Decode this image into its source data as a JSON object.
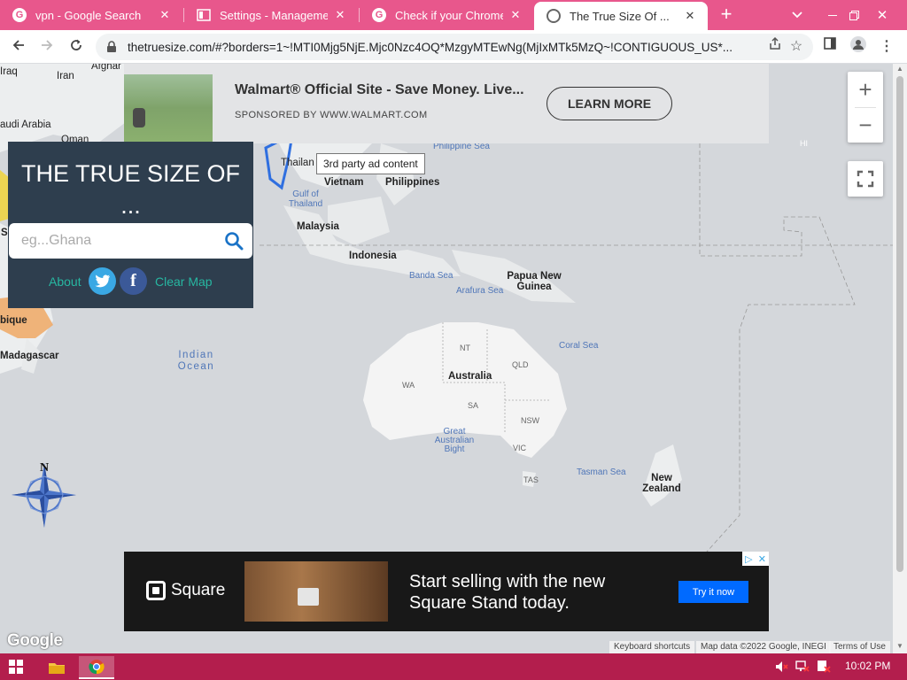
{
  "tabs": [
    {
      "label": "vpn - Google Search",
      "icon": "google-icon"
    },
    {
      "label": "Settings - Management",
      "icon": "settings-page-icon"
    },
    {
      "label": "Check if your Chrome br",
      "icon": "google-icon"
    },
    {
      "label": "The True Size Of ...",
      "icon": "globe-icon"
    }
  ],
  "address_bar": {
    "url": "thetruesize.com/#?borders=1~!MTI0Mjg5NjE.Mjc0Nzc4OQ*MzgyMTEwNg(MjIxMTk5MzQ~!CONTIGUOUS_US*..."
  },
  "top_ad": {
    "title": "Walmart® Official Site - Save Money. Live...",
    "sponsor": "SPONSORED BY WWW.WALMART.COM",
    "cta": "LEARN MORE"
  },
  "tooltip": "3rd party ad content",
  "panel": {
    "title": "THE TRUE SIZE OF ...",
    "search_placeholder": "eg...Ghana",
    "about": "About",
    "clear_map": "Clear Map"
  },
  "map_labels": {
    "iraq": "Iraq",
    "iran": "Iran",
    "afghan": "Afghar",
    "saudi": "audi Arabia",
    "oman": "Oman",
    "thailand": "Thailan",
    "gulf": "Gulf of Thailand",
    "vietnam": "Vietnam",
    "philippines": "Philippines",
    "philippine_sea": "Philippine Sea",
    "malaysia": "Malaysia",
    "indonesia": "Indonesia",
    "banda_sea": "Banda Sea",
    "arafura_sea": "Arafura Sea",
    "png": "Papua New Guinea",
    "coral_sea": "Coral Sea",
    "indian_ocean": "Indian Ocean",
    "australia": "Australia",
    "nt": "NT",
    "qld": "QLD",
    "wa": "WA",
    "sa": "SA",
    "nsw": "NSW",
    "vic": "VIC",
    "tas": "TAS",
    "great_bight": "Great Australian Bight",
    "tasman_sea": "Tasman Sea",
    "nz": "New Zealand",
    "mozambique": "bique",
    "madagascar": "Madagascar",
    "hi": "HI",
    "s_label": "S",
    "compass_n": "N"
  },
  "bottom_ad": {
    "brand": "Square",
    "headline": "Start selling with the new Square Stand today.",
    "cta": "Try it now"
  },
  "map_footer": {
    "google_logo": "Google",
    "keyboard": "Keyboard shortcuts",
    "mapdata": "Map data ©2022 Google, INEGI",
    "terms": "Terms of Use"
  },
  "taskbar": {
    "clock": "10:02 PM"
  },
  "colors": {
    "tab_strip": "#e8578c",
    "panel_bg": "#2e3e4e",
    "panel_link": "#27b7a1",
    "taskbar": "#b31e4d",
    "square_button": "#006aff"
  }
}
